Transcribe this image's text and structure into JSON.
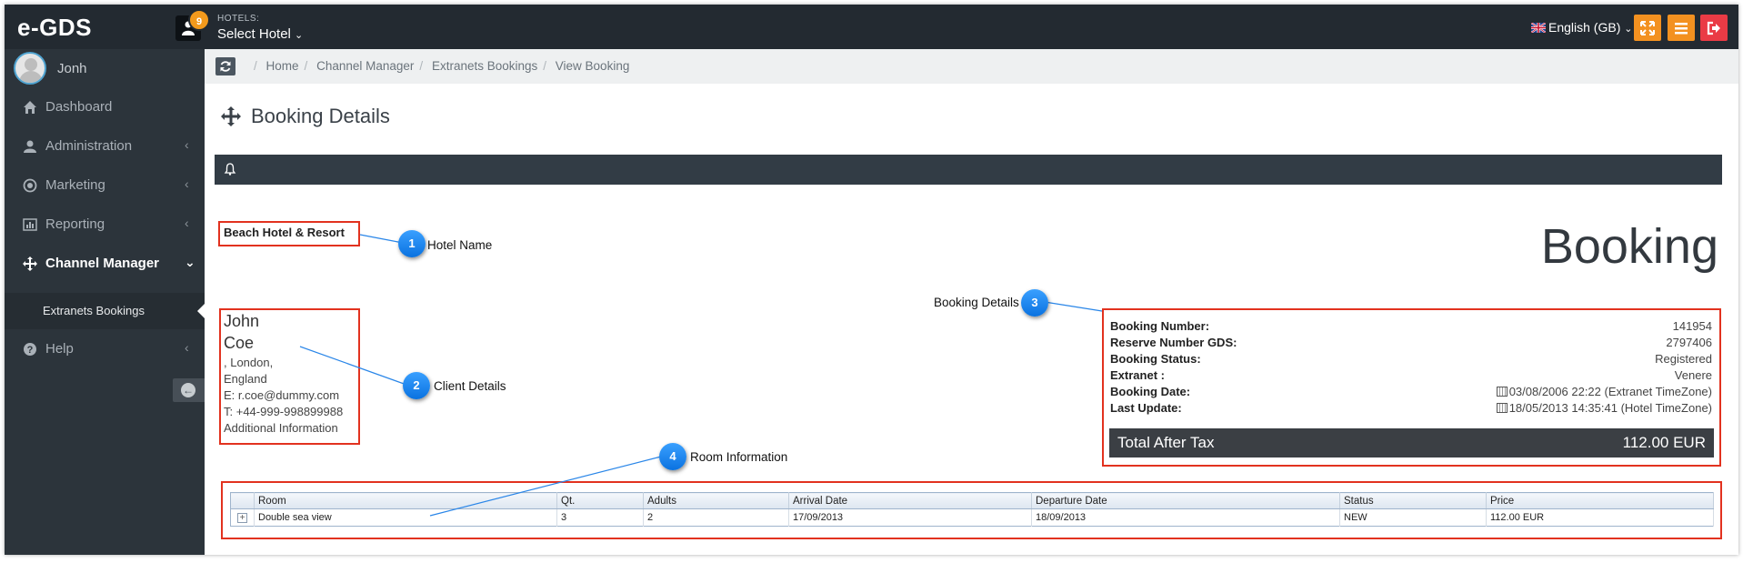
{
  "app": {
    "brand": "e-GDS",
    "notifications_count": "9"
  },
  "topbar": {
    "hotels_label": "HOTELS:",
    "hotel_select": "Select Hotel",
    "language": "English (GB)"
  },
  "sidebar": {
    "username": "Jonh",
    "items": [
      {
        "label": "Dashboard",
        "icon": "home-icon"
      },
      {
        "label": "Administration",
        "icon": "user-icon"
      },
      {
        "label": "Marketing",
        "icon": "target-icon"
      },
      {
        "label": "Reporting",
        "icon": "bar-chart-icon"
      },
      {
        "label": "Channel Manager",
        "icon": "move-arrows-icon"
      },
      {
        "label": "Help",
        "icon": "question-icon"
      }
    ],
    "subitem": "Extranets Bookings"
  },
  "breadcrumb": [
    "Home",
    "Channel Manager",
    "Extranets Bookings",
    "View Booking"
  ],
  "page": {
    "title": "Booking Details"
  },
  "booking": {
    "hotel_name": "Beach Hotel & Resort",
    "heading": "Booking",
    "client": {
      "first_name": "John",
      "last_name": "Coe",
      "city": ", London,",
      "country": "England",
      "email": "E: r.coe@dummy.com",
      "phone": "T: +44-999-998899988",
      "additional": "Additional Information"
    },
    "details": [
      {
        "label": "Booking Number:",
        "value": "141954"
      },
      {
        "label": "Reserve Number GDS:",
        "value": "2797406"
      },
      {
        "label": "Booking Status:",
        "value": "Registered"
      },
      {
        "label": "Extranet :",
        "value": "Venere"
      },
      {
        "label": "Booking Date:",
        "value": "03/08/2006 22:22 (Extranet TimeZone)"
      },
      {
        "label": "Last Update:",
        "value": "18/05/2013 14:35:41 (Hotel TimeZone)"
      }
    ],
    "total_label": "Total After Tax",
    "total_value": "112.00 EUR",
    "rooms": {
      "headers": [
        "",
        "Room",
        "Qt.",
        "Adults",
        "Arrival Date",
        "Departure Date",
        "Status",
        "Price"
      ],
      "rows": [
        {
          "expand": "+",
          "room": "Double sea view",
          "qt": "3",
          "adults": "2",
          "arrival": "17/09/2013",
          "departure": "18/09/2013",
          "status": "NEW",
          "price": "112.00 EUR"
        }
      ]
    }
  },
  "callouts": [
    {
      "number": "1",
      "label": "Hotel Name"
    },
    {
      "number": "2",
      "label": "Client Details"
    },
    {
      "number": "3",
      "label": "Booking Details"
    },
    {
      "number": "4",
      "label": "Room Information"
    }
  ],
  "colors": {
    "accent_orange": "#f39120",
    "logout_red": "#ea3b45",
    "callout_blue": "#1a86f0",
    "highlight_red": "#e2321f",
    "sidebar": "#2c343b"
  }
}
